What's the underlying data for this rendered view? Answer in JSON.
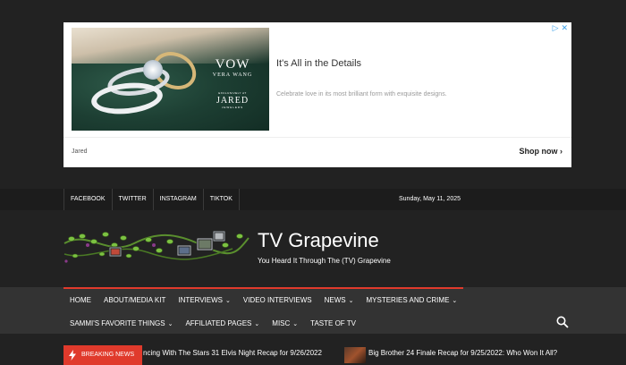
{
  "ad": {
    "choices_label": "▷ ✕",
    "image": {
      "brand_title": "VOW",
      "brand_sub": "VERA WANG",
      "exclusive_line": "EXCLUSIVELY AT",
      "retailer": "JARED",
      "retailer_sub": "JEWELERS"
    },
    "title": "It's All in the Details",
    "description": "Celebrate love in its most brilliant form with exquisite designs.",
    "advertiser": "Jared",
    "cta": "Shop now ›"
  },
  "topbar": {
    "social": [
      "FACEBOOK",
      "TWITTER",
      "INSTAGRAM",
      "TIKTOK"
    ],
    "date": "Sunday, May 11, 2025"
  },
  "header": {
    "site_title": "TV Grapevine",
    "tagline": "You Heard It Through The (TV) Grapevine"
  },
  "nav": {
    "row1": [
      {
        "label": "HOME",
        "chevron": ""
      },
      {
        "label": "ABOUT/MEDIA KIT",
        "chevron": ""
      },
      {
        "label": "INTERVIEWS",
        "chevron": "⌄"
      },
      {
        "label": "VIDEO INTERVIEWS",
        "chevron": ""
      },
      {
        "label": "NEWS",
        "chevron": "⌄"
      },
      {
        "label": "MYSTERIES AND CRIME",
        "chevron": "⌄"
      }
    ],
    "row2": [
      {
        "label": "SAMMI'S FAVORITE THINGS",
        "chevron": "⌄"
      },
      {
        "label": "AFFILIATED PAGES",
        "chevron": "⌄"
      },
      {
        "label": "MISC",
        "chevron": "⌄"
      },
      {
        "label": "TASTE OF TV",
        "chevron": ""
      }
    ],
    "search_icon": "search-icon"
  },
  "ticker": {
    "label": "BREAKING NEWS",
    "item1": "ncing With The Stars 31 Elvis Night Recap for 9/26/2022",
    "item2": "Big Brother 24 Finale Recap for 9/25/2022: Who Won It All?"
  },
  "colors": {
    "accent": "#e03a2c",
    "background": "#222222",
    "nav_bg": "#333333"
  }
}
